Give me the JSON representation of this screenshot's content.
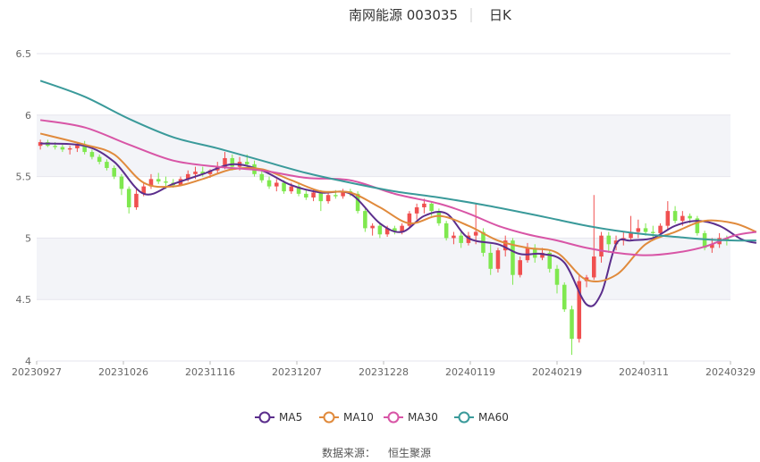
{
  "chart_data": {
    "type": "candlestick",
    "title": "南网能源 003035",
    "period_label": "日K",
    "ylim": [
      4,
      6.5
    ],
    "y_ticks": [
      "4",
      "4.5",
      "5",
      "5.5",
      "6",
      "6.5"
    ],
    "x_tick_labels": [
      "20230927",
      "20231026",
      "20231116",
      "20231207",
      "20231228",
      "20240119",
      "20240219",
      "20240311",
      "20240329"
    ],
    "legend_placement": "bottom",
    "grid": "horizontal bands",
    "colors": {
      "up": "#f05050",
      "down": "#7fe84f",
      "MA5": "#5b2e8c",
      "MA10": "#e08a3c",
      "MA30": "#d855a6",
      "MA60": "#3a9a9a",
      "band": "#f3f4f8",
      "grid": "#e6e6ee"
    },
    "candles_ohlc_approx": [
      [
        5.75,
        5.8,
        5.72,
        5.78
      ],
      [
        5.78,
        5.8,
        5.74,
        5.75
      ],
      [
        5.75,
        5.78,
        5.72,
        5.74
      ],
      [
        5.74,
        5.76,
        5.7,
        5.72
      ],
      [
        5.72,
        5.75,
        5.68,
        5.73
      ],
      [
        5.73,
        5.78,
        5.7,
        5.76
      ],
      [
        5.76,
        5.79,
        5.68,
        5.7
      ],
      [
        5.7,
        5.72,
        5.64,
        5.66
      ],
      [
        5.66,
        5.68,
        5.6,
        5.62
      ],
      [
        5.62,
        5.64,
        5.55,
        5.57
      ],
      [
        5.57,
        5.59,
        5.48,
        5.5
      ],
      [
        5.5,
        5.52,
        5.35,
        5.4
      ],
      [
        5.4,
        5.42,
        5.2,
        5.25
      ],
      [
        5.25,
        5.4,
        5.23,
        5.36
      ],
      [
        5.36,
        5.45,
        5.34,
        5.42
      ],
      [
        5.42,
        5.52,
        5.4,
        5.48
      ],
      [
        5.48,
        5.53,
        5.44,
        5.46
      ],
      [
        5.46,
        5.5,
        5.4,
        5.45
      ],
      [
        5.45,
        5.48,
        5.41,
        5.43
      ],
      [
        5.43,
        5.5,
        5.42,
        5.48
      ],
      [
        5.48,
        5.55,
        5.46,
        5.52
      ],
      [
        5.52,
        5.58,
        5.48,
        5.54
      ],
      [
        5.54,
        5.58,
        5.5,
        5.52
      ],
      [
        5.52,
        5.56,
        5.49,
        5.55
      ],
      [
        5.55,
        5.62,
        5.52,
        5.58
      ],
      [
        5.58,
        5.7,
        5.56,
        5.65
      ],
      [
        5.65,
        5.68,
        5.55,
        5.58
      ],
      [
        5.58,
        5.66,
        5.55,
        5.62
      ],
      [
        5.62,
        5.68,
        5.56,
        5.6
      ],
      [
        5.6,
        5.63,
        5.5,
        5.52
      ],
      [
        5.52,
        5.55,
        5.45,
        5.47
      ],
      [
        5.47,
        5.5,
        5.4,
        5.42
      ],
      [
        5.42,
        5.48,
        5.38,
        5.45
      ],
      [
        5.45,
        5.47,
        5.36,
        5.38
      ],
      [
        5.38,
        5.45,
        5.36,
        5.42
      ],
      [
        5.42,
        5.44,
        5.34,
        5.36
      ],
      [
        5.36,
        5.39,
        5.31,
        5.33
      ],
      [
        5.33,
        5.4,
        5.3,
        5.37
      ],
      [
        5.37,
        5.39,
        5.22,
        5.3
      ],
      [
        5.3,
        5.38,
        5.28,
        5.35
      ],
      [
        5.35,
        5.39,
        5.32,
        5.34
      ],
      [
        5.34,
        5.4,
        5.32,
        5.38
      ],
      [
        5.38,
        5.4,
        5.34,
        5.36
      ],
      [
        5.36,
        5.38,
        5.2,
        5.22
      ],
      [
        5.22,
        5.24,
        5.05,
        5.08
      ],
      [
        5.08,
        5.12,
        5.02,
        5.1
      ],
      [
        5.1,
        5.12,
        5.0,
        5.03
      ],
      [
        5.03,
        5.1,
        5.01,
        5.08
      ],
      [
        5.08,
        5.1,
        5.03,
        5.05
      ],
      [
        5.05,
        5.12,
        5.03,
        5.1
      ],
      [
        5.1,
        5.22,
        5.08,
        5.2
      ],
      [
        5.2,
        5.28,
        5.15,
        5.25
      ],
      [
        5.25,
        5.32,
        5.2,
        5.28
      ],
      [
        5.28,
        5.3,
        5.18,
        5.22
      ],
      [
        5.22,
        5.24,
        5.1,
        5.12
      ],
      [
        5.12,
        5.14,
        4.98,
        5.0
      ],
      [
        5.0,
        5.05,
        4.95,
        5.02
      ],
      [
        5.02,
        5.05,
        4.92,
        4.96
      ],
      [
        4.96,
        5.05,
        4.94,
        5.02
      ],
      [
        5.02,
        5.28,
        4.95,
        5.05
      ],
      [
        5.05,
        5.08,
        4.85,
        4.88
      ],
      [
        4.88,
        4.95,
        4.7,
        4.75
      ],
      [
        4.75,
        4.92,
        4.72,
        4.9
      ],
      [
        4.9,
        5.02,
        4.85,
        4.98
      ],
      [
        4.98,
        5.0,
        4.62,
        4.7
      ],
      [
        4.7,
        4.85,
        4.68,
        4.82
      ],
      [
        4.82,
        4.96,
        4.8,
        4.92
      ],
      [
        4.92,
        4.95,
        4.8,
        4.84
      ],
      [
        4.84,
        4.92,
        4.82,
        4.88
      ],
      [
        4.88,
        4.9,
        4.72,
        4.75
      ],
      [
        4.75,
        4.78,
        4.55,
        4.62
      ],
      [
        4.62,
        4.64,
        4.4,
        4.42
      ],
      [
        4.42,
        4.45,
        4.05,
        4.18
      ],
      [
        4.18,
        4.7,
        4.15,
        4.65
      ],
      [
        4.65,
        4.7,
        4.6,
        4.68
      ],
      [
        4.68,
        5.35,
        4.66,
        4.85
      ],
      [
        4.85,
        5.05,
        4.8,
        5.02
      ],
      [
        5.02,
        5.05,
        4.88,
        4.95
      ],
      [
        4.95,
        5.02,
        4.9,
        4.98
      ],
      [
        4.98,
        5.05,
        4.94,
        5.0
      ],
      [
        5.0,
        5.18,
        4.98,
        5.05
      ],
      [
        5.05,
        5.15,
        5.0,
        5.08
      ],
      [
        5.08,
        5.12,
        5.02,
        5.05
      ],
      [
        5.05,
        5.1,
        5.0,
        5.04
      ],
      [
        5.04,
        5.12,
        5.02,
        5.1
      ],
      [
        5.1,
        5.3,
        5.06,
        5.22
      ],
      [
        5.22,
        5.26,
        5.12,
        5.14
      ],
      [
        5.14,
        5.22,
        5.1,
        5.18
      ],
      [
        5.18,
        5.2,
        5.12,
        5.16
      ],
      [
        5.16,
        5.18,
        5.02,
        5.04
      ],
      [
        5.04,
        5.06,
        4.9,
        4.92
      ],
      [
        4.92,
        5.0,
        4.88,
        4.95
      ],
      [
        4.95,
        5.04,
        4.92,
        5.0
      ],
      [
        5.0,
        5.02,
        4.94,
        4.98
      ]
    ],
    "series": [
      {
        "name": "MA5",
        "approx_points": [
          [
            0,
            5.77
          ],
          [
            6,
            5.75
          ],
          [
            10,
            5.62
          ],
          [
            14,
            5.36
          ],
          [
            18,
            5.44
          ],
          [
            22,
            5.52
          ],
          [
            26,
            5.6
          ],
          [
            30,
            5.55
          ],
          [
            34,
            5.43
          ],
          [
            38,
            5.37
          ],
          [
            42,
            5.36
          ],
          [
            46,
            5.12
          ],
          [
            49,
            5.05
          ],
          [
            52,
            5.18
          ],
          [
            55,
            5.2
          ],
          [
            58,
            5.0
          ],
          [
            62,
            4.95
          ],
          [
            65,
            4.87
          ],
          [
            68,
            4.87
          ],
          [
            71,
            4.8
          ],
          [
            74,
            4.46
          ],
          [
            76,
            4.55
          ],
          [
            78,
            4.95
          ],
          [
            80,
            4.98
          ],
          [
            83,
            5.0
          ],
          [
            86,
            5.1
          ],
          [
            89,
            5.14
          ],
          [
            92,
            5.1
          ],
          [
            95,
            4.99
          ],
          [
            97,
            4.96
          ]
        ]
      },
      {
        "name": "MA10",
        "approx_points": [
          [
            0,
            5.85
          ],
          [
            6,
            5.76
          ],
          [
            10,
            5.68
          ],
          [
            14,
            5.45
          ],
          [
            18,
            5.42
          ],
          [
            22,
            5.48
          ],
          [
            26,
            5.56
          ],
          [
            30,
            5.56
          ],
          [
            34,
            5.47
          ],
          [
            38,
            5.38
          ],
          [
            42,
            5.37
          ],
          [
            46,
            5.25
          ],
          [
            50,
            5.12
          ],
          [
            54,
            5.18
          ],
          [
            58,
            5.1
          ],
          [
            62,
            4.98
          ],
          [
            66,
            4.92
          ],
          [
            70,
            4.88
          ],
          [
            74,
            4.66
          ],
          [
            78,
            4.7
          ],
          [
            82,
            4.95
          ],
          [
            86,
            5.05
          ],
          [
            90,
            5.14
          ],
          [
            94,
            5.12
          ],
          [
            97,
            5.05
          ]
        ]
      },
      {
        "name": "MA30",
        "approx_points": [
          [
            0,
            5.96
          ],
          [
            6,
            5.9
          ],
          [
            12,
            5.76
          ],
          [
            18,
            5.63
          ],
          [
            24,
            5.58
          ],
          [
            30,
            5.55
          ],
          [
            36,
            5.49
          ],
          [
            42,
            5.47
          ],
          [
            48,
            5.36
          ],
          [
            54,
            5.28
          ],
          [
            58,
            5.2
          ],
          [
            62,
            5.1
          ],
          [
            66,
            5.03
          ],
          [
            70,
            4.98
          ],
          [
            74,
            4.92
          ],
          [
            78,
            4.88
          ],
          [
            82,
            4.86
          ],
          [
            86,
            4.88
          ],
          [
            90,
            4.93
          ],
          [
            94,
            5.02
          ],
          [
            97,
            5.05
          ]
        ]
      },
      {
        "name": "MA60",
        "approx_points": [
          [
            0,
            6.28
          ],
          [
            6,
            6.15
          ],
          [
            12,
            5.97
          ],
          [
            18,
            5.82
          ],
          [
            24,
            5.73
          ],
          [
            30,
            5.63
          ],
          [
            36,
            5.53
          ],
          [
            42,
            5.45
          ],
          [
            48,
            5.38
          ],
          [
            54,
            5.33
          ],
          [
            60,
            5.27
          ],
          [
            66,
            5.2
          ],
          [
            70,
            5.15
          ],
          [
            74,
            5.1
          ],
          [
            78,
            5.06
          ],
          [
            82,
            5.03
          ],
          [
            86,
            5.01
          ],
          [
            90,
            4.99
          ],
          [
            94,
            4.98
          ],
          [
            97,
            4.98
          ]
        ]
      }
    ]
  },
  "legend": {
    "items": [
      "MA5",
      "MA10",
      "MA30",
      "MA60"
    ]
  },
  "footer": {
    "source_label": "数据来源：",
    "source_name": "恒生聚源"
  }
}
